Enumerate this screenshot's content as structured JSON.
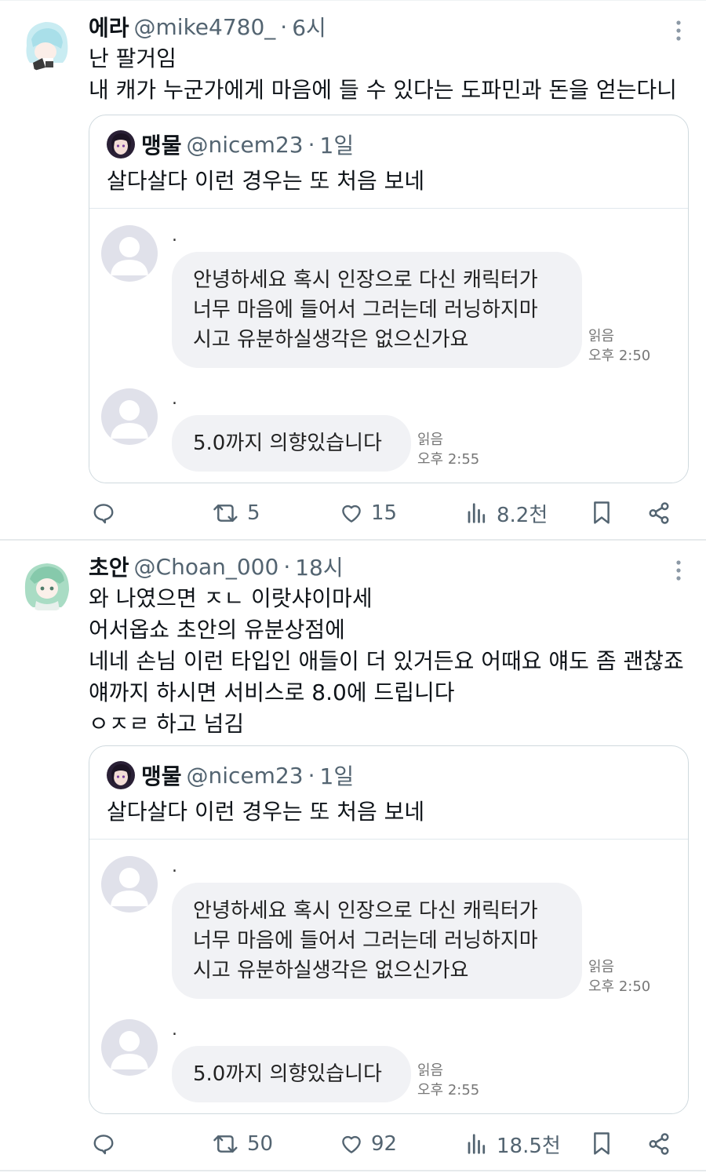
{
  "colors": {
    "text": "#0f1419",
    "muted": "#536471",
    "border": "#cfd9de",
    "bubble": "#f1f2f5"
  },
  "icons": [
    "more-vertical-icon",
    "reply-icon",
    "retweet-icon",
    "like-icon",
    "views-icon",
    "bookmark-icon",
    "share-icon",
    "default-avatar-icon"
  ],
  "tweets": [
    {
      "name": "에라",
      "handle": "@mike4780_",
      "dot": "·",
      "time": "6시",
      "lines": [
        "난 팔거임",
        "내 캐가 누군가에게 마음에 들 수 있다는 도파민과 돈을 얻는다니"
      ],
      "quote": {
        "name": "맹물",
        "handle": "@nicem23",
        "dot": "·",
        "time": "1일",
        "text": "살다살다 이런 경우는 또 처음 보네",
        "dm": [
          {
            "sender_mark": ".",
            "lines": [
              "안녕하세요 혹시 인장으로 다신 캐릭터가",
              "너무 마음에 들어서 그러는데 러닝하지마",
              "시고 유분하실생각은 없으신가요"
            ],
            "read": "읽음",
            "time": "오후 2:50"
          },
          {
            "sender_mark": ".",
            "lines": [
              "5.0까지 의향있습니다"
            ],
            "read": "읽음",
            "time": "오후 2:55"
          }
        ]
      },
      "stats": {
        "retweets": "5",
        "likes": "15",
        "views": "8.2천"
      }
    },
    {
      "name": "초안",
      "handle": "@Choan_000",
      "dot": "·",
      "time": "18시",
      "lines": [
        "와 나였으면 ㅈㄴ 이랏샤이마세",
        "어서옵쇼 초안의 유분상점에",
        "네네 손님 이런 타입인 애들이 더 있거든요 어때요 얘도 좀 괜찮죠",
        "얘까지 하시면 서비스로 8.0에 드립니다",
        "ㅇㅈㄹ 하고 넘김"
      ],
      "quote": {
        "name": "맹물",
        "handle": "@nicem23",
        "dot": "·",
        "time": "1일",
        "text": "살다살다 이런 경우는 또 처음 보네",
        "dm": [
          {
            "sender_mark": ".",
            "lines": [
              "안녕하세요 혹시 인장으로 다신 캐릭터가",
              "너무 마음에 들어서 그러는데 러닝하지마",
              "시고 유분하실생각은 없으신가요"
            ],
            "read": "읽음",
            "time": "오후 2:50"
          },
          {
            "sender_mark": ".",
            "lines": [
              "5.0까지 의향있습니다"
            ],
            "read": "읽음",
            "time": "오후 2:55"
          }
        ]
      },
      "stats": {
        "retweets": "50",
        "likes": "92",
        "views": "18.5천"
      }
    }
  ]
}
